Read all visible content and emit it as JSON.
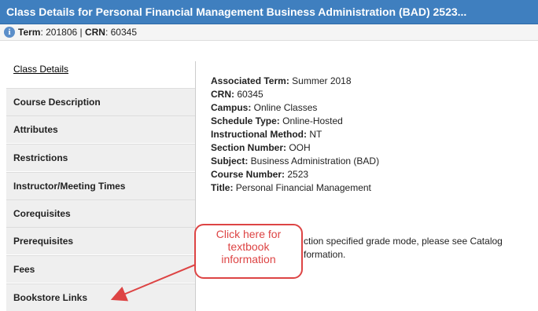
{
  "titlebar": {
    "title": "Class Details for Personal Financial Management Business Administration (BAD) 2523..."
  },
  "termbar": {
    "term_label": "Term",
    "term_value": ": 201806 | ",
    "crn_label": "CRN",
    "crn_value": ": 60345"
  },
  "tabs": [
    {
      "label": "Class Details"
    },
    {
      "label": "Course Description"
    },
    {
      "label": "Attributes"
    },
    {
      "label": "Restrictions"
    },
    {
      "label": "Instructor/Meeting Times"
    },
    {
      "label": "Corequisites"
    },
    {
      "label": "Prerequisites"
    },
    {
      "label": "Fees"
    },
    {
      "label": "Bookstore Links"
    }
  ],
  "details": [
    {
      "label": "Associated Term:",
      "value": " Summer 2018"
    },
    {
      "label": "CRN:",
      "value": " 60345"
    },
    {
      "label": "Campus:",
      "value": " Online Classes"
    },
    {
      "label": "Schedule Type:",
      "value": " Online-Hosted"
    },
    {
      "label": "Instructional Method:",
      "value": " NT"
    },
    {
      "label": "Section Number:",
      "value": " OOH"
    },
    {
      "label": "Subject:",
      "value": " Business Administration (BAD)"
    },
    {
      "label": "Course Number:",
      "value": " 2523"
    },
    {
      "label": "Title:",
      "value": " Personal Financial Management"
    }
  ],
  "note": {
    "line1": "ction specified grade mode, please see Catalog",
    "line2": "formation."
  },
  "callout": {
    "text": "Click here for\ntextbook\ninformation"
  },
  "colors": {
    "titlebar": "#3f7fbf",
    "callout": "#dd4444"
  }
}
